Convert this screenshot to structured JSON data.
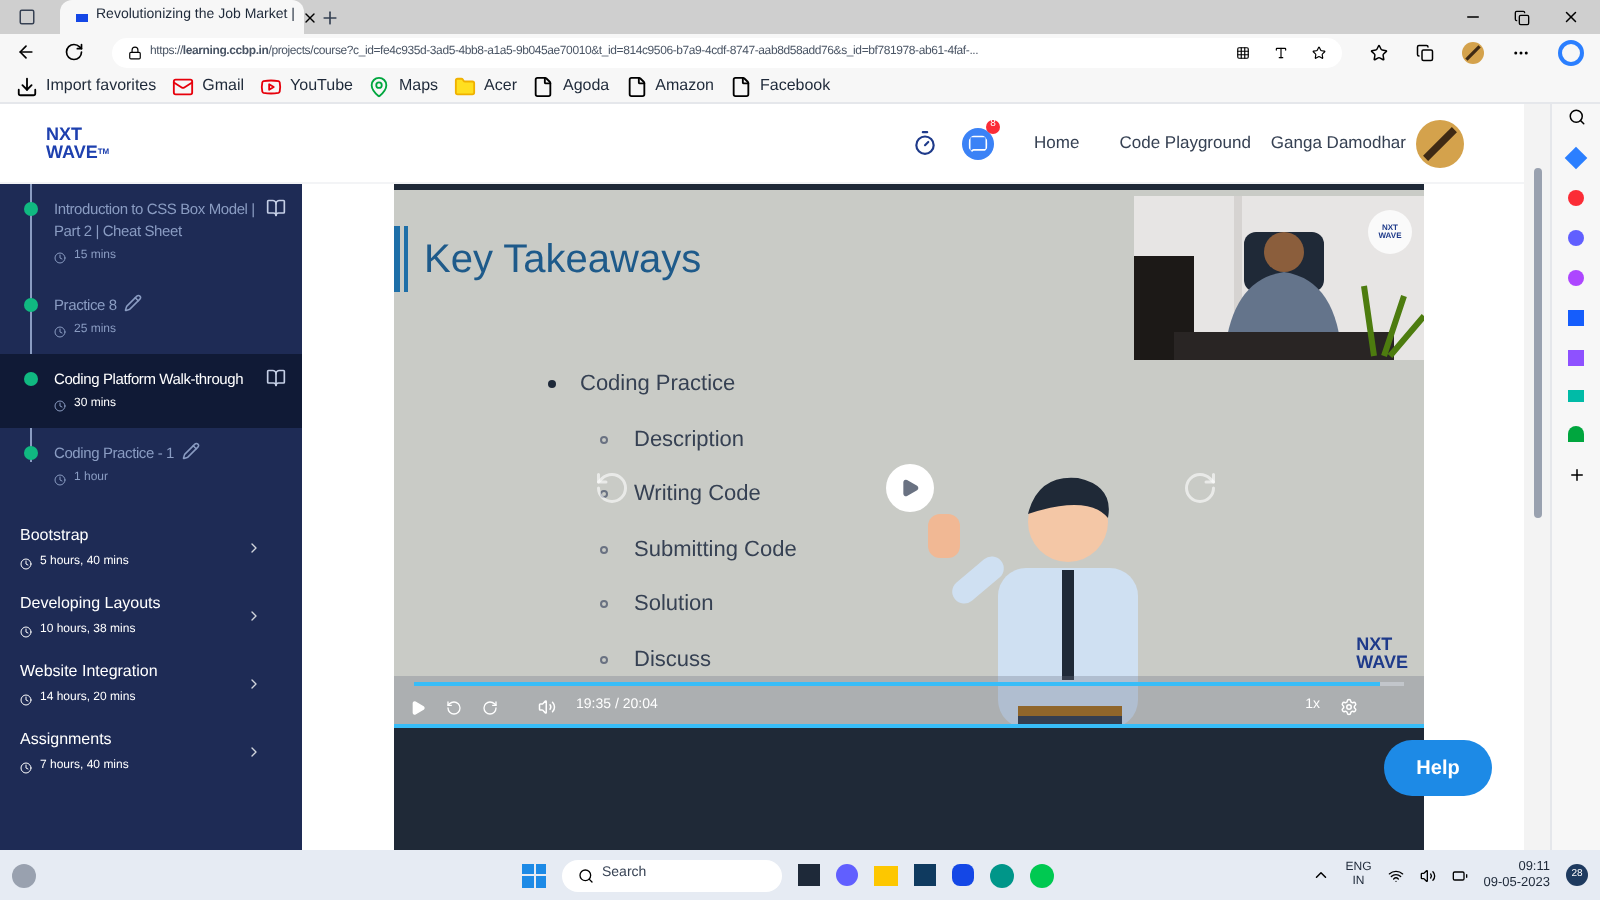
{
  "browser": {
    "tab_title": "Revolutionizing the Job Market |",
    "url": "https://**learning.ccbp.in**/projects/course?c_id=fe4c935d-3ad5-4bb8-a1a5-9b045ae70010&t_id=814c9506-b7a9-4cdf-8747-aab8d58add76&s_id=bf781978-ab61-4faf-...",
    "favorites": [
      {
        "label": "Import favorites",
        "kind": "import"
      },
      {
        "label": "Gmail",
        "kind": "gmail"
      },
      {
        "label": "YouTube",
        "kind": "youtube"
      },
      {
        "label": "Maps",
        "kind": "maps"
      },
      {
        "label": "Acer",
        "kind": "folder"
      },
      {
        "label": "Agoda",
        "kind": "page"
      },
      {
        "label": "Amazon",
        "kind": "page"
      },
      {
        "label": "Facebook",
        "kind": "page"
      }
    ]
  },
  "header": {
    "logo_top": "NXT",
    "logo_bottom": "WAVE",
    "logo_mark": "TM",
    "chat_badge": "8",
    "nav": [
      "Home",
      "Code Playground"
    ],
    "user_name": "Ganga Damodhar"
  },
  "lessons": [
    {
      "title": "Introduction to CSS Box Model | Part 2 | Cheat Sheet",
      "duration": "15 mins",
      "kind": "reading",
      "completed": true,
      "selected": false
    },
    {
      "title": "Practice 8",
      "duration": "25 mins",
      "kind": "practice",
      "completed": true,
      "selected": false
    },
    {
      "title": "Coding Platform Walk-through",
      "duration": "30 mins",
      "kind": "reading",
      "completed": true,
      "selected": true
    },
    {
      "title": "Coding Practice - 1",
      "duration": "1 hour",
      "kind": "practice",
      "completed": true,
      "selected": false
    }
  ],
  "modules": [
    {
      "title": "Bootstrap",
      "duration": "5 hours, 40 mins"
    },
    {
      "title": "Developing Layouts",
      "duration": "10 hours, 38 mins"
    },
    {
      "title": "Website Integration",
      "duration": "14 hours, 20 mins"
    },
    {
      "title": "Assignments",
      "duration": "7 hours, 40 mins"
    }
  ],
  "slide": {
    "title": "Key Takeaways",
    "bullet": "Coding Practice",
    "sub_bullets": [
      "Description",
      "Writing Code",
      "Submitting Code",
      "Solution",
      "Discuss"
    ],
    "webcam_logo_top": "NXT",
    "webcam_logo_bottom": "WAVE",
    "watermark_top": "NXT",
    "watermark_bottom": "WAVE"
  },
  "player": {
    "current": "19:35",
    "separator": "/",
    "total": "20:04",
    "speed": "1x",
    "progress": {
      "level": 0.975
    }
  },
  "help_button": "Help",
  "taskbar": {
    "search_placeholder": "Search",
    "language": "ENG",
    "region": "IN",
    "time": "09:11",
    "date": "09-05-2023",
    "notifications": "28"
  }
}
